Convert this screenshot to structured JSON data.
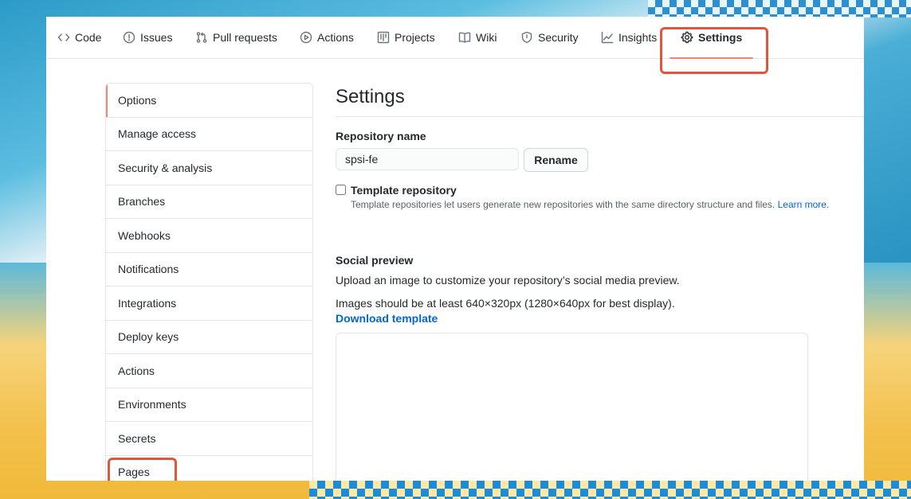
{
  "nav": {
    "items": [
      {
        "label": "Code",
        "icon": "code-icon"
      },
      {
        "label": "Issues",
        "icon": "issue-opened-icon"
      },
      {
        "label": "Pull requests",
        "icon": "git-pull-request-icon"
      },
      {
        "label": "Actions",
        "icon": "play-icon"
      },
      {
        "label": "Projects",
        "icon": "project-icon"
      },
      {
        "label": "Wiki",
        "icon": "book-icon"
      },
      {
        "label": "Security",
        "icon": "shield-icon"
      },
      {
        "label": "Insights",
        "icon": "graph-icon"
      },
      {
        "label": "Settings",
        "icon": "gear-icon"
      }
    ],
    "active": "Settings"
  },
  "sidebar": {
    "items": [
      {
        "label": "Options"
      },
      {
        "label": "Manage access"
      },
      {
        "label": "Security & analysis"
      },
      {
        "label": "Branches"
      },
      {
        "label": "Webhooks"
      },
      {
        "label": "Notifications"
      },
      {
        "label": "Integrations"
      },
      {
        "label": "Deploy keys"
      },
      {
        "label": "Actions"
      },
      {
        "label": "Environments"
      },
      {
        "label": "Secrets"
      },
      {
        "label": "Pages"
      }
    ],
    "selected": "Options"
  },
  "main": {
    "title": "Settings",
    "repo_name_label": "Repository name",
    "repo_name_value": "spsi-fe",
    "rename_button": "Rename",
    "template_label": "Template repository",
    "template_note": "Template repositories let users generate new repositories with the same directory structure and files.",
    "learn_more": "Learn more.",
    "social_label": "Social preview",
    "social_desc": "Upload an image to customize your repository’s social media preview.",
    "social_size": "Images should be at least 640×320px (1280×640px for best display).",
    "download_template": "Download template"
  },
  "colors": {
    "accent_underline": "#f9826c",
    "highlight_box": "#e0553b",
    "link": "#0366d6"
  }
}
